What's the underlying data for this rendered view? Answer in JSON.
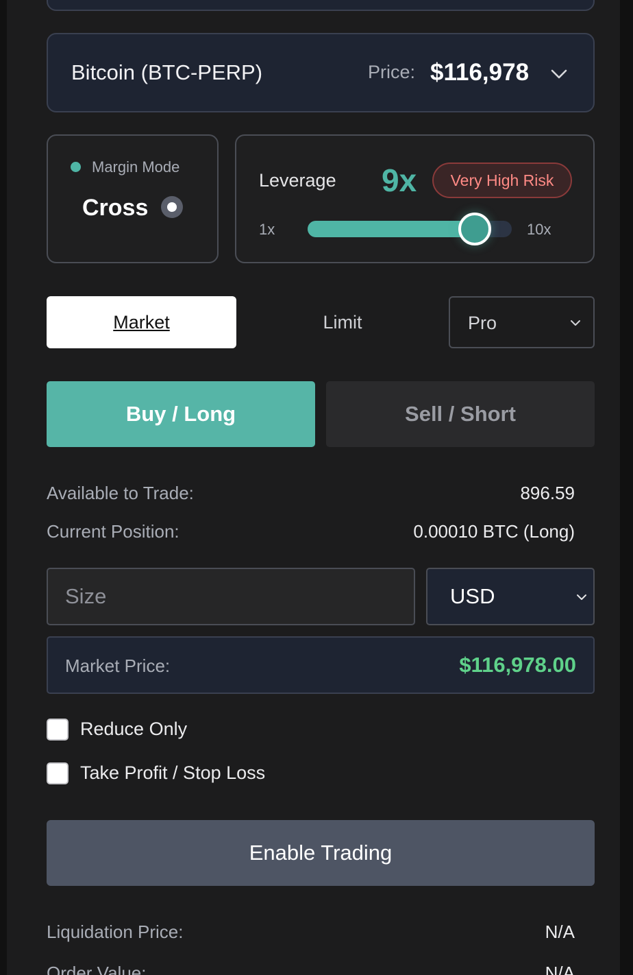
{
  "market": {
    "name": "Bitcoin (BTC-PERP)",
    "price_label": "Price:",
    "price_value": "$116,978"
  },
  "margin": {
    "label": "Margin Mode",
    "mode": "Cross"
  },
  "leverage": {
    "label": "Leverage",
    "value": "9x",
    "risk": "Very High Risk",
    "min_label": "1x",
    "max_label": "10x",
    "min": 1,
    "max": 10,
    "current": 9
  },
  "order_type": {
    "market": "Market",
    "limit": "Limit",
    "pro": "Pro"
  },
  "side": {
    "buy": "Buy / Long",
    "sell": "Sell / Short"
  },
  "account": {
    "available_label": "Available to Trade:",
    "available_value": "896.59",
    "position_label": "Current Position:",
    "position_value": "0.00010 BTC (Long)"
  },
  "size": {
    "placeholder": "Size",
    "unit": "USD"
  },
  "market_price": {
    "label": "Market Price:",
    "value": "$116,978.00"
  },
  "options": {
    "reduce_only": "Reduce Only",
    "tp_sl": "Take Profit / Stop Loss"
  },
  "actions": {
    "enable_trading": "Enable Trading"
  },
  "summary": {
    "liquidation_label": "Liquidation Price:",
    "liquidation_value": "N/A",
    "order_value_label": "Order Value:",
    "order_value_value": "N/A"
  },
  "colors": {
    "accent": "#4fb5a5",
    "risk": "#ff8a85",
    "price_green": "#5fd18a"
  }
}
